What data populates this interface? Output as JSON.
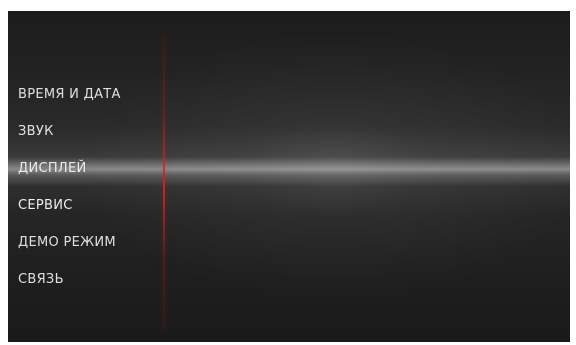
{
  "menu": {
    "items": [
      {
        "label": "ВРЕМЯ И ДАТА"
      },
      {
        "label": "ЗВУК"
      },
      {
        "label": "ДИСПЛЕЙ"
      },
      {
        "label": "СЕРВИС"
      },
      {
        "label": "ДЕМО РЕЖИМ"
      },
      {
        "label": "СВЯЗЬ"
      }
    ],
    "selected_index": 3
  },
  "theme": {
    "accent_line": "#d22323",
    "text": "#ffffff",
    "background": "#1f1f1f"
  }
}
